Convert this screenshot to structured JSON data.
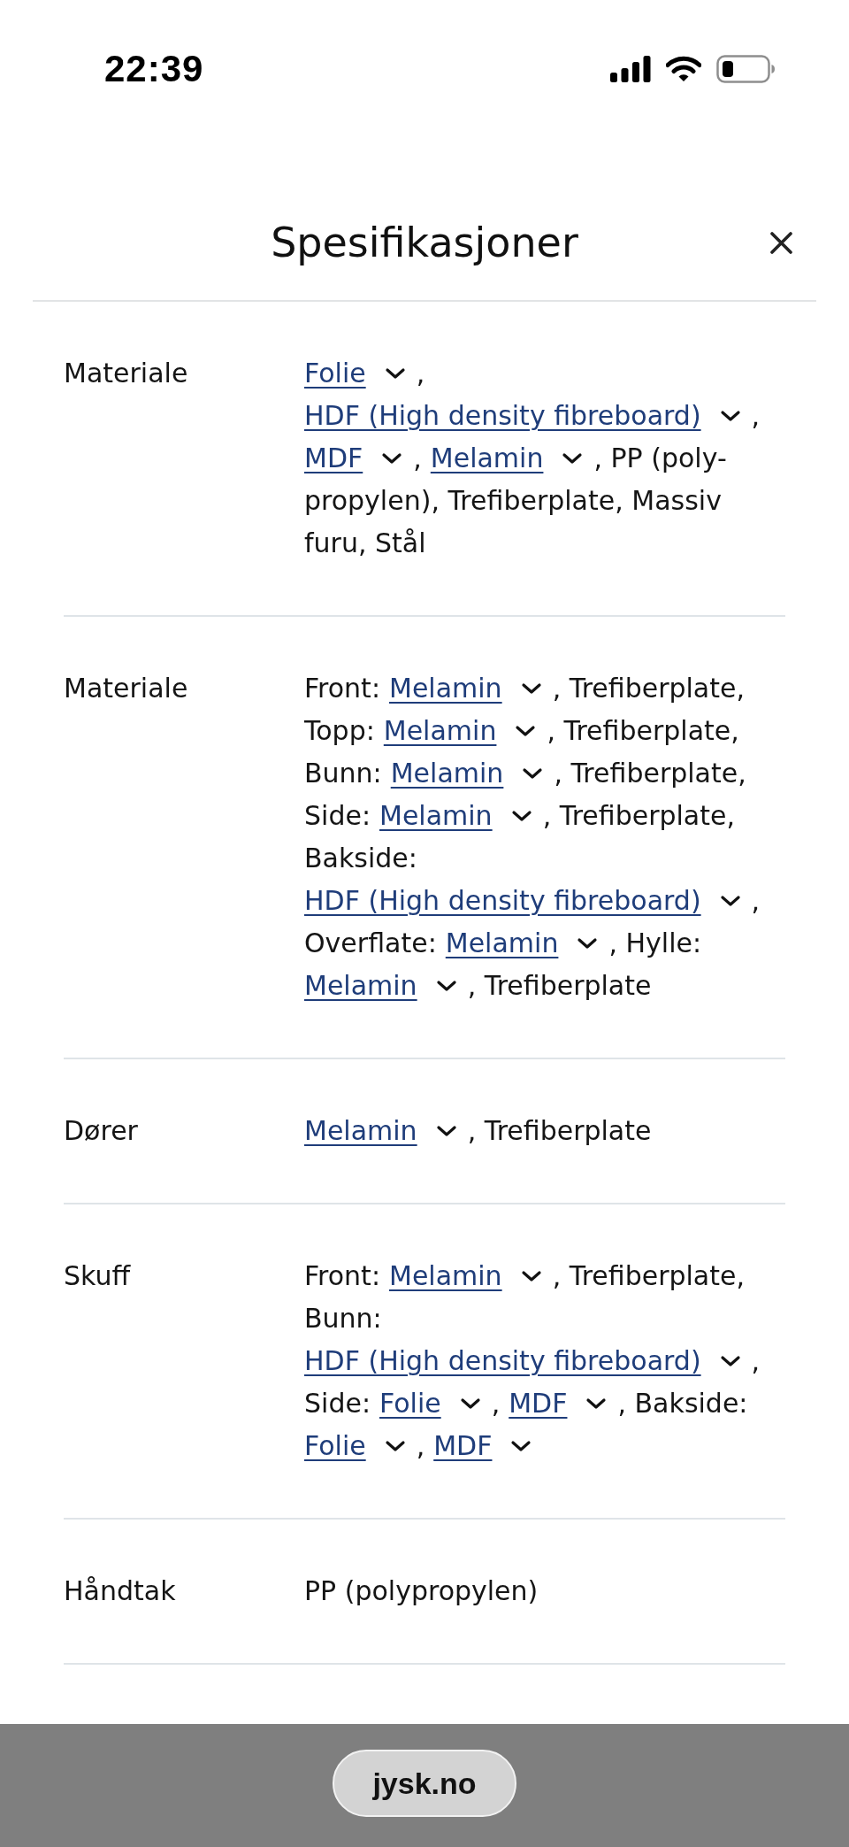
{
  "status_bar": {
    "time": "22:39"
  },
  "header": {
    "title": "Spesifikasjoner"
  },
  "specs": [
    {
      "label": "Materiale",
      "lines": [
        [
          {
            "kind": "link",
            "text": "Folie",
            "expanded": false
          },
          {
            "kind": "text",
            "text": ","
          }
        ],
        [
          {
            "kind": "link",
            "text": "HDF (High density fibreboard)",
            "expanded": false
          },
          {
            "kind": "text",
            "text": ","
          }
        ],
        [
          {
            "kind": "link",
            "text": "MDF",
            "expanded": false
          },
          {
            "kind": "text",
            "text": ","
          },
          {
            "kind": "link",
            "text": "Melamin",
            "expanded": false
          },
          {
            "kind": "text",
            "text": ", PP (poly-"
          }
        ],
        [
          {
            "kind": "text",
            "text": "propylen), Trefiberplate, Massiv"
          }
        ],
        [
          {
            "kind": "text",
            "text": "furu, Stål"
          }
        ]
      ]
    },
    {
      "label": "Materiale",
      "lines": [
        [
          {
            "kind": "text",
            "text": "Front:"
          },
          {
            "kind": "link",
            "text": "Melamin",
            "expanded": false
          },
          {
            "kind": "text",
            "text": ", Trefiberplate,"
          }
        ],
        [
          {
            "kind": "text",
            "text": "Topp:"
          },
          {
            "kind": "link",
            "text": "Melamin",
            "expanded": false
          },
          {
            "kind": "text",
            "text": ", Trefiberplate,"
          }
        ],
        [
          {
            "kind": "text",
            "text": "Bunn:"
          },
          {
            "kind": "link",
            "text": "Melamin",
            "expanded": false
          },
          {
            "kind": "text",
            "text": ", Trefiberplate,"
          }
        ],
        [
          {
            "kind": "text",
            "text": "Side:"
          },
          {
            "kind": "link",
            "text": "Melamin",
            "expanded": false
          },
          {
            "kind": "text",
            "text": ", Trefiberplate,"
          }
        ],
        [
          {
            "kind": "text",
            "text": "Bakside:"
          }
        ],
        [
          {
            "kind": "link",
            "text": "HDF (High density fibreboard)",
            "expanded": false
          },
          {
            "kind": "text",
            "text": ","
          }
        ],
        [
          {
            "kind": "text",
            "text": "Overflate:"
          },
          {
            "kind": "link",
            "text": "Melamin",
            "expanded": false
          },
          {
            "kind": "text",
            "text": ", Hylle:"
          }
        ],
        [
          {
            "kind": "link",
            "text": "Melamin",
            "expanded": false
          },
          {
            "kind": "text",
            "text": ", Trefiberplate"
          }
        ]
      ]
    },
    {
      "label": "Dører",
      "lines": [
        [
          {
            "kind": "link",
            "text": "Melamin",
            "expanded": false
          },
          {
            "kind": "text",
            "text": ", Trefiberplate"
          }
        ]
      ]
    },
    {
      "label": "Skuff",
      "lines": [
        [
          {
            "kind": "text",
            "text": "Front:"
          },
          {
            "kind": "link",
            "text": "Melamin",
            "expanded": false
          },
          {
            "kind": "text",
            "text": ", Trefiberplate,"
          }
        ],
        [
          {
            "kind": "text",
            "text": "Bunn:"
          }
        ],
        [
          {
            "kind": "link",
            "text": "HDF (High density fibreboard)",
            "expanded": false
          },
          {
            "kind": "text",
            "text": ","
          }
        ],
        [
          {
            "kind": "text",
            "text": "Side:"
          },
          {
            "kind": "link",
            "text": "Folie",
            "expanded": false
          },
          {
            "kind": "text",
            "text": ","
          },
          {
            "kind": "link",
            "text": "MDF",
            "expanded": false
          },
          {
            "kind": "text",
            "text": ", Bakside:"
          }
        ],
        [
          {
            "kind": "link",
            "text": "Folie",
            "expanded": false
          },
          {
            "kind": "text",
            "text": ","
          },
          {
            "kind": "link",
            "text": "MDF",
            "expanded": false
          }
        ]
      ]
    },
    {
      "label": "Håndtak",
      "lines": [
        [
          {
            "kind": "text",
            "text": "PP (polypropylen)"
          }
        ]
      ]
    }
  ],
  "browser_bar": {
    "url": "jysk.no"
  }
}
